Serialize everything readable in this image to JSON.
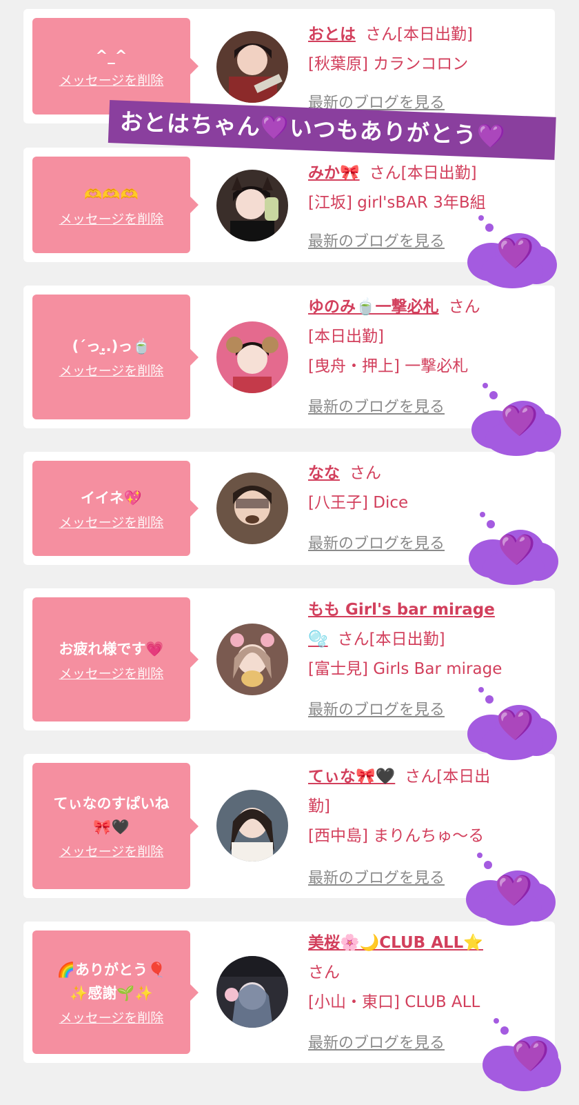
{
  "delete_label": "メッセージを削除",
  "blog_label": "最新のブログを見る",
  "banner_text": "おとはちゃん💜いつもありがとう💜",
  "cloud_heart": "💜",
  "items": [
    {
      "message": "^_^",
      "name": "おとは",
      "san": "さん[本日出勤]",
      "shop_lines": [
        "[秋葉原] カランコロン"
      ]
    },
    {
      "message": "🫶🫶🫶",
      "name": "みか🎀",
      "san": "さん[本日出勤]",
      "shop_lines": [
        "[江坂] girl'sBAR 3年B組"
      ]
    },
    {
      "message": "(´っ.̫.)っ🍵",
      "name": "ゆのみ🍵一撃必札",
      "san": "さん",
      "shop_lines": [
        "[本日出勤]",
        "[曳舟・押上] 一撃必札"
      ]
    },
    {
      "message": "イイネ💖",
      "name": "なな",
      "san": "さん",
      "shop_lines": [
        "[八王子] Dice"
      ]
    },
    {
      "message": "お疲れ様です💗",
      "name": "もも Girl's bar mirage",
      "name2": "🫧",
      "san": "さん[本日出勤]",
      "shop_lines": [
        "[富士見] Girls Bar mirage"
      ]
    },
    {
      "message": "てぃなのすぱいね",
      "message2": "🎀🖤",
      "name": "てぃな🎀🖤",
      "san": "さん[本日出",
      "san2": "勤]",
      "shop_lines": [
        "[西中島] まりんちゅ〜る"
      ]
    },
    {
      "message": "🌈ありがとう🎈",
      "message2": "✨感謝🌱✨",
      "name": "美桜🌸🌙CLUB ALL⭐",
      "san": "さん",
      "shop_lines": [
        "[小山・東口] CLUB ALL"
      ]
    }
  ],
  "colors": {
    "accent": "#d23f5c",
    "bubble": "#f58fa0",
    "cloud": "#a45be0",
    "banner": "#8a3f9e"
  }
}
